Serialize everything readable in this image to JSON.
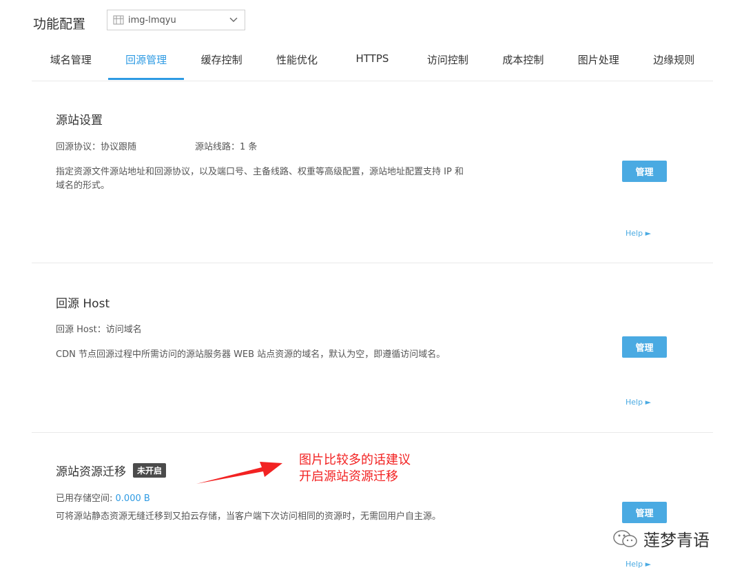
{
  "header": {
    "title": "功能配置",
    "bucket_selector": {
      "value": "img-lmqyu"
    }
  },
  "tabs": [
    {
      "label": "域名管理",
      "active": false
    },
    {
      "label": "回源管理",
      "active": true
    },
    {
      "label": "缓存控制",
      "active": false
    },
    {
      "label": "性能优化",
      "active": false
    },
    {
      "label": "HTTPS",
      "active": false
    },
    {
      "label": "访问控制",
      "active": false
    },
    {
      "label": "成本控制",
      "active": false
    },
    {
      "label": "图片处理",
      "active": false
    },
    {
      "label": "边缘规则",
      "active": false
    }
  ],
  "sections": {
    "origin": {
      "title": "源站设置",
      "protocol": "回源协议：协议跟随",
      "lines": "源站线路：1 条",
      "description_line1": "指定资源文件源站地址和回源协议，以及端口号、主备线路、权重等高级配置，源站地址配置支持 IP 和",
      "description_line2": "域名的形式。",
      "manage_label": "管理",
      "help_label": "Help ►"
    },
    "host": {
      "title": "回源 Host",
      "host_value": "回源 Host：访问域名",
      "description": "CDN 节点回源过程中所需访问的源站服务器 WEB 站点资源的域名，默认为空，即遵循访问域名。",
      "manage_label": "管理",
      "help_label": "Help ►"
    },
    "migration": {
      "title": "源站资源迁移",
      "status_badge": "未开启",
      "storage_label": "已用存储空间: ",
      "storage_value": "0.000 B",
      "description": "可将源站静态资源无缝迁移到又拍云存储，当客户端下次访问相同的资源时，无需回用户自主源。",
      "manage_label": "管理",
      "help_label": "Help ►"
    }
  },
  "annotation": {
    "line1": "图片比较多的话建议",
    "line2": "开启源站资源迁移",
    "color": "#f22222"
  },
  "watermark": {
    "text": "莲梦青语"
  },
  "colors": {
    "accent": "#2d9ae3",
    "button": "#4aaae2",
    "badge": "#4b4b4b"
  }
}
